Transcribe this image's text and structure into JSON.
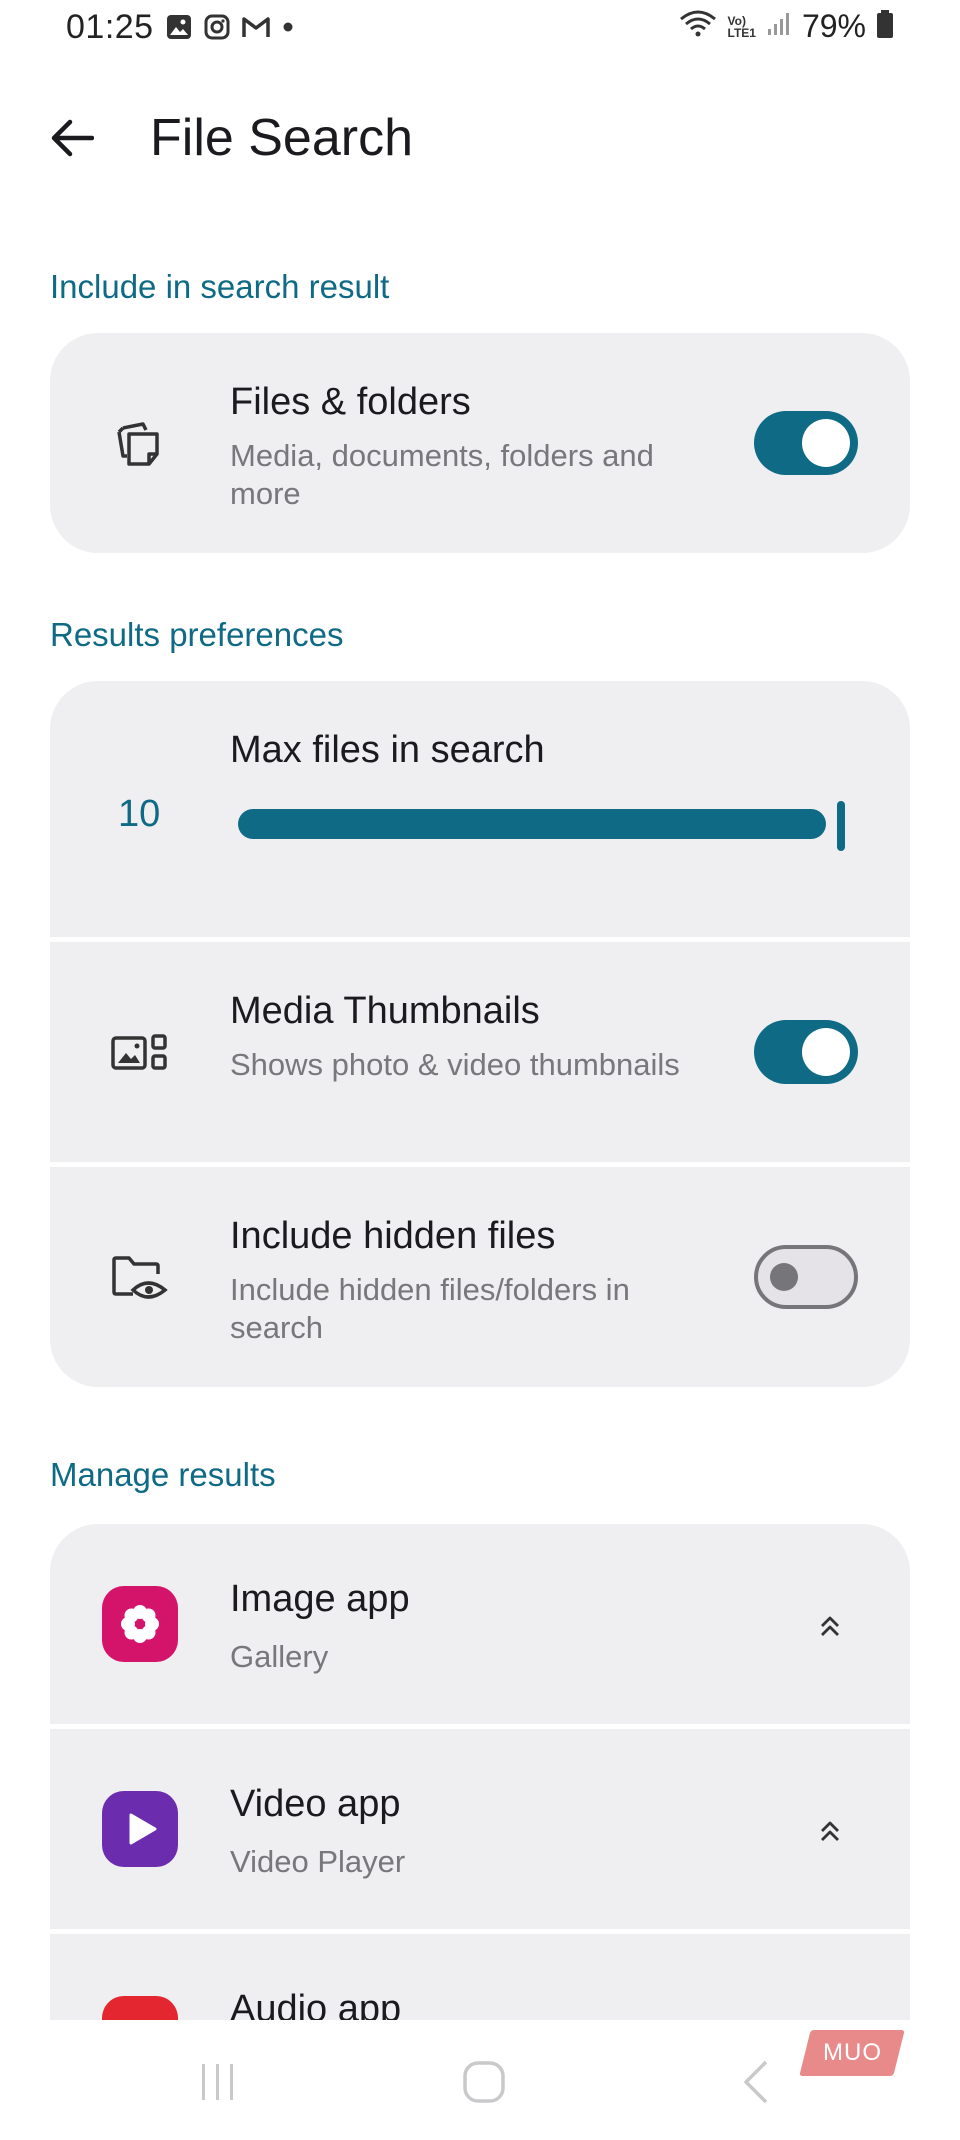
{
  "status_bar": {
    "time": "01:25",
    "left_icons": [
      "gallery-icon",
      "instagram-icon",
      "gmail-icon",
      "dot-icon"
    ],
    "right_icons": [
      "wifi-icon",
      "volte-icon",
      "signal-icon",
      "battery-icon"
    ],
    "battery_percent": "79%",
    "volte_label": "Vo)",
    "lte_label": "LTE1"
  },
  "app_bar": {
    "title": "File Search",
    "back_icon": "arrow-back-icon"
  },
  "sections": {
    "include": {
      "header": "Include in search result"
    },
    "preferences": {
      "header": "Results preferences"
    },
    "manage": {
      "header": "Manage results"
    }
  },
  "files_folders": {
    "title": "Files & folders",
    "subtitle": "Media, documents, folders and more",
    "icon": "files-copy-icon",
    "enabled": true
  },
  "max_files": {
    "title": "Max files in search",
    "value": "10",
    "slider_fraction": 1.0
  },
  "media_thumbnails": {
    "title": "Media Thumbnails",
    "subtitle": "Shows photo & video thumbnails",
    "icon": "photo-thumbnail-icon",
    "enabled": true
  },
  "hidden_files": {
    "title": "Include hidden files",
    "subtitle": "Include hidden files/folders in search",
    "icon": "folder-eye-icon",
    "enabled": false
  },
  "apps": [
    {
      "title": "Image app",
      "subtitle": "Gallery",
      "icon": "gallery-flower-icon",
      "color": "#d4146a"
    },
    {
      "title": "Video app",
      "subtitle": "Video Player",
      "icon": "play-icon",
      "color": "#6b2cad"
    },
    {
      "title": "Audio app",
      "subtitle": "",
      "icon": "audio-icon",
      "color": "#e3262f"
    }
  ],
  "nav": {
    "recents": "recents-icon",
    "home": "home-icon",
    "back": "back-chevron-icon"
  },
  "watermark": "MUO",
  "colors": {
    "accent": "#0f6a85",
    "card_bg": "#efeff1",
    "subtitle": "#77777c"
  }
}
